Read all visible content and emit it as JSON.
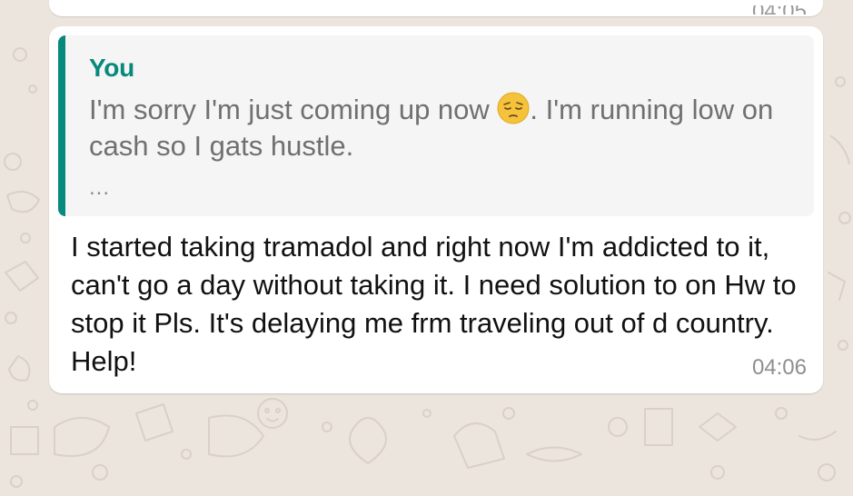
{
  "colors": {
    "wallpaper": "#ece5dd",
    "bubble": "#ffffff",
    "quote_background": "#f5f5f5",
    "quote_accent": "#07897b",
    "quoted_text": "#707070",
    "message_text": "#111111",
    "timestamp": "#8e8e8e"
  },
  "previous_message": {
    "time": "04:05"
  },
  "message": {
    "quoted": {
      "author": "You",
      "text_before_emoji": "I'm sorry I'm just coming up now ",
      "emoji_icon": "pensive-face-emoji-icon",
      "text_after_emoji": ". I'm running low on cash so I gats hustle.",
      "more": "..."
    },
    "text": "I started taking tramadol and right now I'm addicted to it, can't go a day without taking it. I need solution to on Hw to stop it Pls. It's delaying me frm traveling out of d country. Help!",
    "time": "04:06"
  }
}
